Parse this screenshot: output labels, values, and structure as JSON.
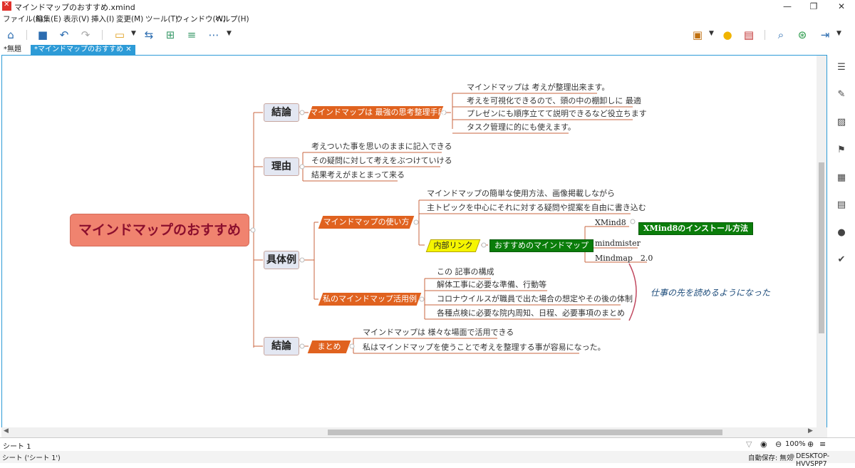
{
  "window": {
    "title": "マインドマップのおすすめ.xmind"
  },
  "menu": [
    "ファイル(F)",
    "編集(E)",
    "表示(V)",
    "挿入(I)",
    "変更(M)",
    "ツール(T)",
    "ウィンドウ(W)",
    "ヘルプ(H)"
  ],
  "tabs": [
    {
      "label": "*無題"
    },
    {
      "label": "*マインドマップのおすすめ",
      "close": "✕"
    }
  ],
  "map": {
    "central": "マインドマップのおすすめ",
    "topics": {
      "conclusion1": "結論",
      "reason": "理由",
      "examples": "具体例",
      "conclusion2": "結論"
    },
    "conclusion1_sub": "マインドマップは 最強の思考整理手段",
    "conclusion1_leaves": [
      "マインドマップは 考えが整理出来ます。",
      "考えを可視化できるので、頭の中の棚卸しに 最適",
      "プレゼンにも順序立てて説明できるなど役立ちます",
      "タスク管理に的にも使えます。"
    ],
    "reason_leaves": [
      "考えついた事を思いのままに記入できる",
      "その疑問に対して考えをぶつけていける",
      "結果考えがまとまって来る"
    ],
    "howto": "マインドマップの使い方",
    "howto_leaves": [
      "マインドマップの簡単な使用方法、画像掲載しながら",
      "主トピックを中心にそれに対する疑問や提案を自由に書き込む"
    ],
    "link": "内部リンク",
    "recommend": "おすすめのマインドマップ",
    "tools": [
      "XMind8",
      "mindmister",
      "Mindmap　2.0"
    ],
    "xmind_install": "XMind8のインストール方法",
    "usage": "私のマインドマップ活用例",
    "usage_leaves": [
      "この 記事の構成",
      "解体工事に必要な準備、行動等",
      "コロナウイルスが職員で出た場合の想定やその後の体制",
      "各種点検に必要な院内周知、日程、必要事項のまとめ"
    ],
    "note": "仕事の先を読めるようになった",
    "summary": "まとめ",
    "summary_leaves": [
      "マインドマップは 様々な場面で活用できる",
      "私はマインドマップを使うことで考えを整理する事が容易になった。"
    ]
  },
  "sheet": {
    "tab": "シート 1",
    "zoom": "100%"
  },
  "status": {
    "left": "シート ('シート 1')",
    "autosave": "自動保存: 無効",
    "machine": "DESKTOP-HVVSPP7"
  },
  "colors": {
    "branch": "#e0621f",
    "accent": "#2d9bd7",
    "central": "#f0836f",
    "link": "#f5f500",
    "green": "#0a7d0a"
  }
}
